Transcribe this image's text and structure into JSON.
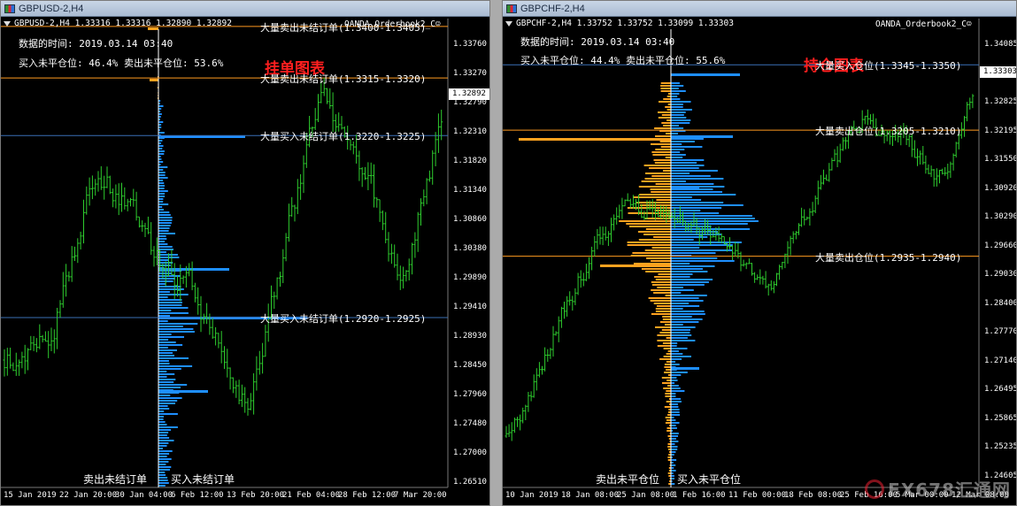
{
  "colors": {
    "buy": "#1e8fff",
    "sell": "#ffa21f",
    "candle": "#2ecc2e",
    "grid_line": "#3a6fb5",
    "orange_line": "#ff9a1f",
    "red_line": "#d01010",
    "title_red": "#ff1f1f"
  },
  "left": {
    "window_title": "GBPUSD-2,H4",
    "chart_info": "GBPUSD-2,H4  1.33316 1.33316 1.32890 1.32892",
    "indicator_name": "OANDA_Orderbook2_C☺",
    "time_line": "数据的时间: 2019.03.14 03:40",
    "ratio_line": "买入未平仓位: 46.4%  卖出未平仓位: 53.6%",
    "big_title": "挂单图表",
    "levels": [
      {
        "label": "大量卖出未结订单(1.3400-1.3405)",
        "price": 1.34,
        "color": "orange"
      },
      {
        "label": "大量卖出未结订单(1.3315-1.3320)",
        "price": 1.3315,
        "color": "orange"
      },
      {
        "label": "大量买入未结订单(1.3220-1.3225)",
        "price": 1.322,
        "color": "blue"
      },
      {
        "label": "大量买入未结订单(1.2920-1.2925)",
        "price": 1.292,
        "color": "blue"
      }
    ],
    "current_price": "1.32892",
    "price_ticks": [
      "1.33760",
      "1.33270",
      "1.32790",
      "1.32310",
      "1.31820",
      "1.31340",
      "1.30860",
      "1.30380",
      "1.29890",
      "1.29410",
      "1.28930",
      "1.28450",
      "1.27960",
      "1.27480",
      "1.27000",
      "1.26510"
    ],
    "time_ticks": [
      "15 Jan 2019",
      "22 Jan 20:00",
      "30 Jan 04:00",
      "6 Feb 12:00",
      "13 Feb 20:00",
      "21 Feb 04:00",
      "28 Feb 12:00",
      "7 Mar 20:00"
    ],
    "bottom_left_label": "卖出未结订单",
    "bottom_right_label": "买入未结订单"
  },
  "right": {
    "window_title": "GBPCHF-2,H4",
    "chart_info": "GBPCHF-2,H4  1.33752 1.33752 1.33099 1.33303",
    "indicator_name": "OANDA_Orderbook2_C☺",
    "time_line": "数据的时间: 2019.03.14 03:40",
    "ratio_line": "买入未平仓位: 44.4%  卖出未平仓位: 55.6%",
    "big_title": "持仓图表",
    "levels": [
      {
        "label": "大量买入仓位(1.3345-1.3350)",
        "price": 1.3345,
        "color": "blue"
      },
      {
        "label": "大量卖出仓位(1.3205-1.3210)",
        "price": 1.3205,
        "color": "orange"
      },
      {
        "label": "大量卖出仓位(1.2935-1.2940)",
        "price": 1.2935,
        "color": "orange"
      }
    ],
    "current_price": "1.33303",
    "price_ticks": [
      "1.34085",
      "1.33455",
      "1.32825",
      "1.32195",
      "1.31550",
      "1.30920",
      "1.30290",
      "1.29660",
      "1.29030",
      "1.28400",
      "1.27770",
      "1.27140",
      "1.26495",
      "1.25865",
      "1.25235",
      "1.24605"
    ],
    "time_ticks": [
      "10 Jan 2019",
      "18 Jan 08:00",
      "25 Jan 08:00",
      "1 Feb 16:00",
      "11 Feb 00:00",
      "18 Feb 08:00",
      "25 Feb 16:00",
      "5 Mar 00:00",
      "12 Mar 08:00"
    ],
    "bottom_left_label": "卖出未平仓位",
    "bottom_right_label": "买入未平仓位"
  },
  "watermark_text": "FX678汇通网"
}
